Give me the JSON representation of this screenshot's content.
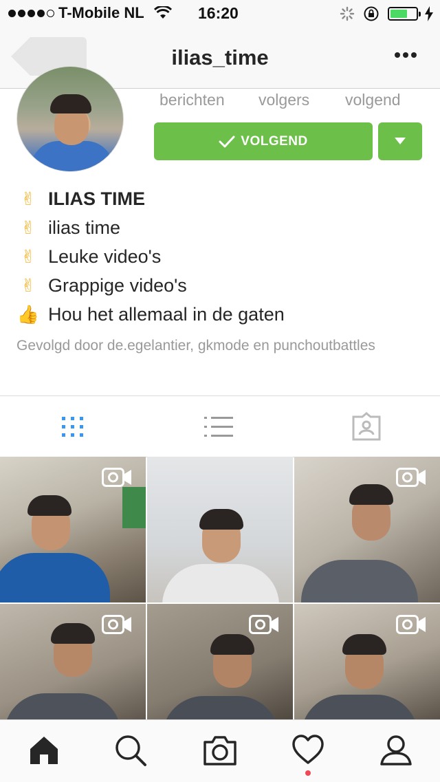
{
  "status_bar": {
    "carrier": "T-Mobile NL",
    "time": "16:20",
    "signal_dots_filled": 4,
    "signal_dots_total": 5,
    "battery_level": 0.55
  },
  "nav": {
    "username": "ilias_time"
  },
  "profile": {
    "stats": [
      {
        "label": "berichten"
      },
      {
        "label": "volgers"
      },
      {
        "label": "volgend"
      }
    ],
    "follow_button": "VOLGEND",
    "bio": [
      {
        "emoji": "✌",
        "text": "ILIAS TIME",
        "bold": true
      },
      {
        "emoji": "✌",
        "text": "ilias time"
      },
      {
        "emoji": "✌",
        "text": "Leuke video's"
      },
      {
        "emoji": "✌",
        "text": "Grappige video's"
      },
      {
        "emoji": "👍",
        "text": "Hou het allemaal in de gaten"
      }
    ],
    "followed_by": "Gevolgd door de.egelantier, gkmode en punchoutbattles"
  },
  "tabs": [
    {
      "icon": "grid-icon",
      "active": true
    },
    {
      "icon": "list-icon",
      "active": false
    },
    {
      "icon": "tagged-icon",
      "active": false
    }
  ],
  "posts": [
    {
      "type": "video"
    },
    {
      "type": "photo"
    },
    {
      "type": "video"
    },
    {
      "type": "video"
    },
    {
      "type": "video"
    },
    {
      "type": "video"
    }
  ],
  "bottom_tabs": [
    {
      "icon": "home-icon",
      "active": true
    },
    {
      "icon": "search-icon"
    },
    {
      "icon": "camera-icon"
    },
    {
      "icon": "heart-icon",
      "has_notification": true
    },
    {
      "icon": "profile-icon"
    }
  ],
  "colors": {
    "follow_green": "#6cc04a",
    "active_tab_blue": "#3897f0",
    "notification_red": "#ed4956"
  }
}
